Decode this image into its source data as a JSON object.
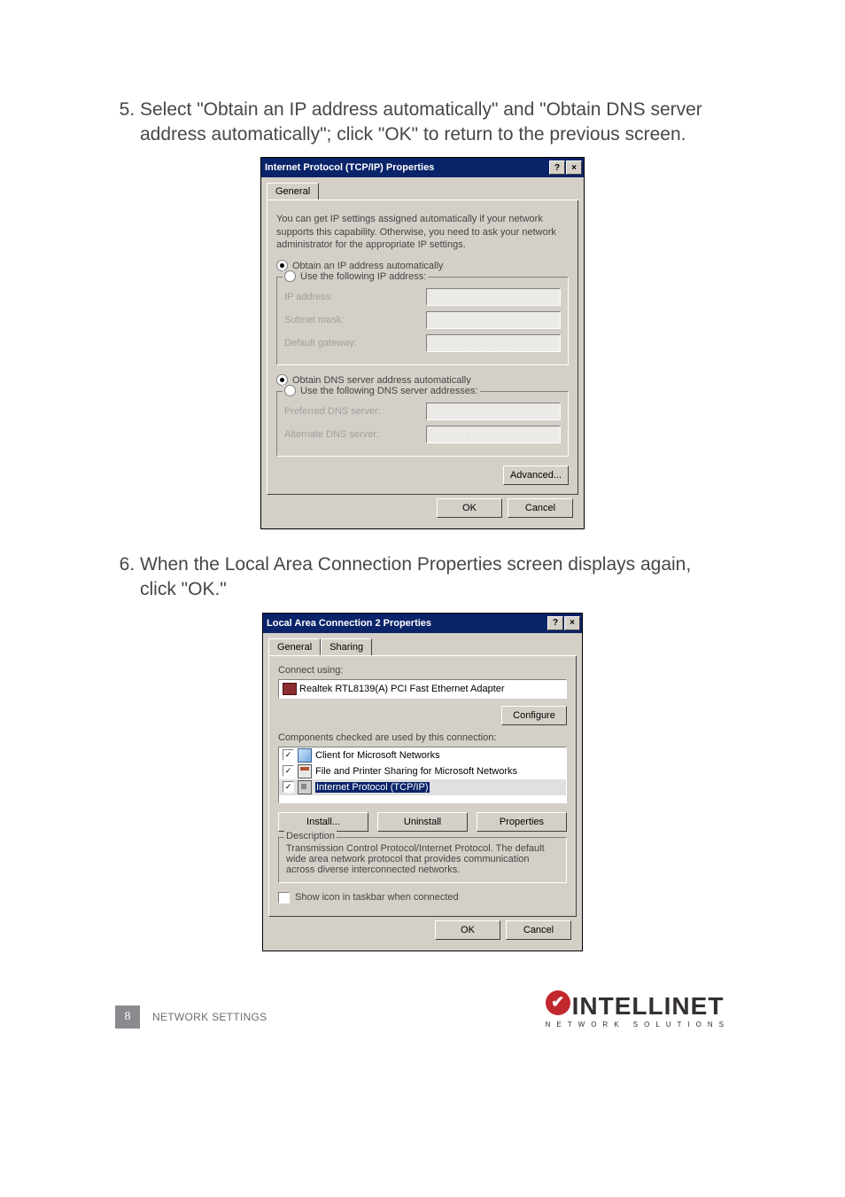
{
  "steps": {
    "s5": {
      "num": "5.",
      "text": "Select \"Obtain an IP address automatically\" and \"Obtain DNS server address automatically\"; click \"OK\" to return to the previous screen."
    },
    "s6": {
      "num": "6.",
      "text": "When the Local Area Connection Properties screen displays again, click \"OK.\""
    }
  },
  "dlg1": {
    "title": "Internet Protocol (TCP/IP) Properties",
    "help_glyph": "?",
    "close_glyph": "×",
    "tab_general": "General",
    "intro": "You can get IP settings assigned automatically if your network supports this capability. Otherwise, you need to ask your network administrator for the appropriate IP settings.",
    "r_ip_auto": "Obtain an IP address automatically",
    "r_ip_use": "Use the following IP address:",
    "lbl_ip": "IP address:",
    "lbl_mask": "Subnet mask:",
    "lbl_gw": "Default gateway:",
    "r_dns_auto": "Obtain DNS server address automatically",
    "r_dns_use": "Use the following DNS server addresses:",
    "lbl_dns1": "Preferred DNS server:",
    "lbl_dns2": "Alternate DNS server:",
    "btn_adv": "Advanced...",
    "btn_ok": "OK",
    "btn_cancel": "Cancel"
  },
  "dlg2": {
    "title": "Local Area Connection 2 Properties",
    "help_glyph": "?",
    "close_glyph": "×",
    "tab_general": "General",
    "tab_sharing": "Sharing",
    "connect_using": "Connect using:",
    "adapter": "Realtek RTL8139(A) PCI Fast Ethernet Adapter",
    "btn_configure": "Configure",
    "components_label": "Components checked are used by this connection:",
    "items": {
      "c0": {
        "label": "Client for Microsoft Networks",
        "check": "✓"
      },
      "c1": {
        "label": "File and Printer Sharing for Microsoft Networks",
        "check": "✓"
      },
      "c2": {
        "label": "Internet Protocol (TCP/IP)",
        "check": "✓"
      }
    },
    "btn_install": "Install...",
    "btn_uninstall": "Uninstall",
    "btn_props": "Properties",
    "desc_legend": "Description",
    "desc_text": "Transmission Control Protocol/Internet Protocol. The default wide area network protocol that provides communication across diverse interconnected networks.",
    "show_icon": "Show icon in taskbar when connected",
    "btn_ok": "OK",
    "btn_cancel": "Cancel"
  },
  "footer": {
    "page_num": "8",
    "section": "NETWORK SETTINGS",
    "brand": {
      "check": "✔",
      "name": "INTELLINET",
      "sub": "NETWORK SOLUTIONS"
    }
  }
}
